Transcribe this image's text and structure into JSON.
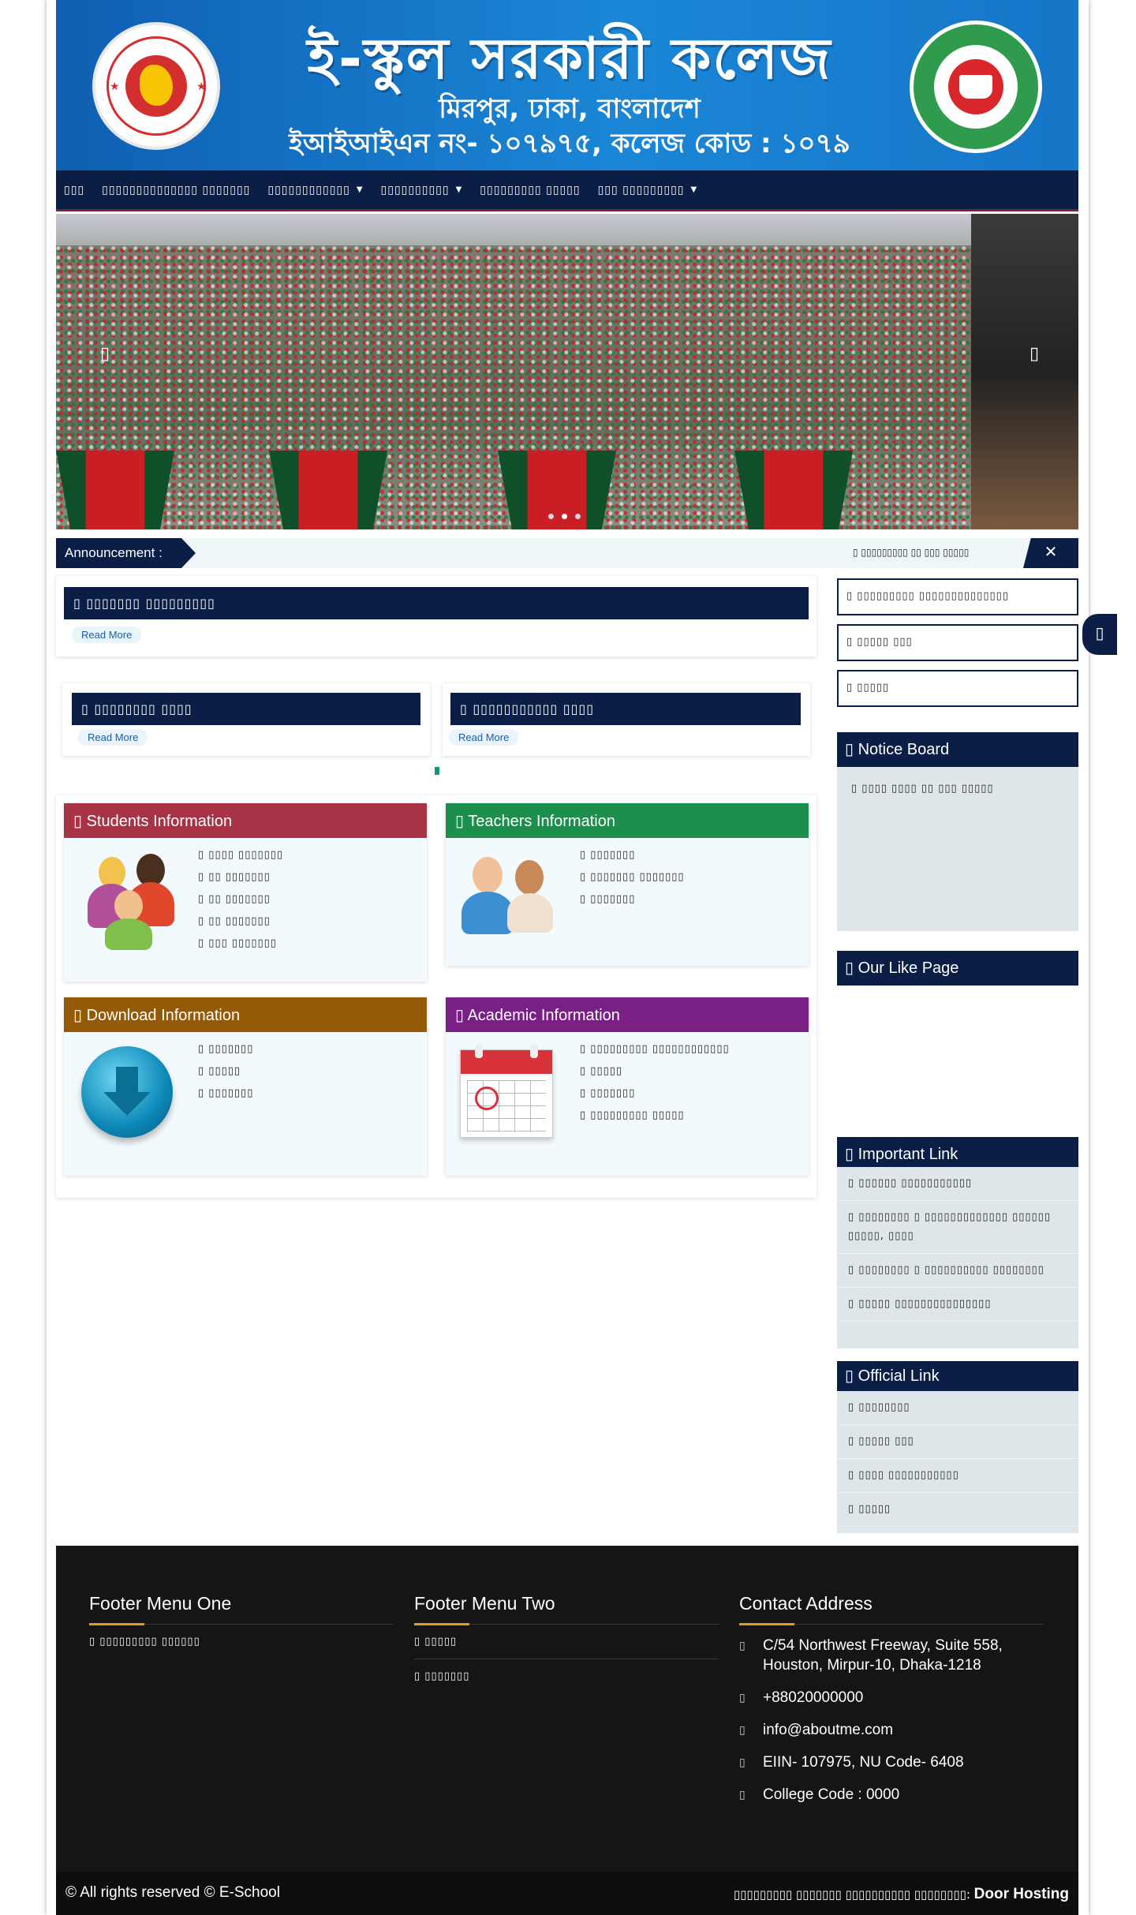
{
  "header": {
    "title": "ই-স্কুল সরকারী কলেজ",
    "subtitle": "মিরপুর, ঢাকা, বাংলাদেশ",
    "code_line": "ইআইআইএন নং- ১০৭৯৭৫, কলেজ কোড : ১০৭৯"
  },
  "nav": {
    "items": [
      {
        "label": "▯▯▯",
        "has_caret": false
      },
      {
        "label": "▯▯▯▯▯▯▯▯▯▯▯▯▯▯ ▯▯▯▯▯▯▯",
        "has_caret": false
      },
      {
        "label": "▯▯▯▯▯▯▯▯▯▯▯▯",
        "has_caret": true
      },
      {
        "label": "▯▯▯▯▯▯▯▯▯▯",
        "has_caret": true
      },
      {
        "label": "▯▯▯▯▯▯▯▯▯ ▯▯▯▯▯",
        "has_caret": false
      },
      {
        "label": "▯▯▯ ▯▯▯▯▯▯▯▯▯",
        "has_caret": true
      }
    ]
  },
  "slider": {
    "prev": "▯",
    "next": "▯",
    "dots": 3,
    "active_dot": 1
  },
  "announcement": {
    "label": "Announcement :",
    "text": "▯ ▯▯▯▯▯▯▯▯▯ ▯▯ ▯▯▯ ▯▯▯▯▯",
    "close": "✕"
  },
  "main": {
    "featured": {
      "title": "▯ ▯▯▯▯▯▯▯ ▯▯▯▯▯▯▯▯▯",
      "read_more": "Read More"
    },
    "cards": [
      {
        "title": "▯ ▯▯▯▯▯▯▯▯ ▯▯▯▯",
        "read_more": "Read More"
      },
      {
        "title": "▯ ▯▯▯▯▯▯▯▯▯▯▯ ▯▯▯▯",
        "read_more": "Read More"
      }
    ],
    "info_boxes": [
      {
        "title": "▯ Students Information",
        "color": "#a83346",
        "items": [
          "▯ ▯▯▯▯ ▯▯▯▯▯▯▯",
          "▯ ▯▯ ▯▯▯▯▯▯▯",
          "▯ ▯▯ ▯▯▯▯▯▯▯",
          "▯ ▯▯ ▯▯▯▯▯▯▯",
          "▯ ▯▯▯ ▯▯▯▯▯▯▯"
        ]
      },
      {
        "title": "▯ Teachers Information",
        "color": "#1b8f4b",
        "items": [
          "▯ ▯▯▯▯▯▯▯",
          "▯ ▯▯▯▯▯▯▯ ▯▯▯▯▯▯▯",
          "▯ ▯▯▯▯▯▯▯"
        ]
      },
      {
        "title": "▯ Download Information",
        "color": "#945a06",
        "items": [
          "▯ ▯▯▯▯▯▯▯",
          "▯ ▯▯▯▯▯",
          "▯ ▯▯▯▯▯▯▯"
        ]
      },
      {
        "title": "▯ Academic Information",
        "color": "#7a1f86",
        "items": [
          "▯ ▯▯▯▯▯▯▯▯▯ ▯▯▯▯▯▯▯▯▯▯▯▯",
          "▯ ▯▯▯▯▯",
          "▯ ▯▯▯▯▯▯▯",
          "▯ ▯▯▯▯▯▯▯▯▯ ▯▯▯▯▯"
        ]
      }
    ]
  },
  "sidebar": {
    "buttons": [
      "▯ ▯▯▯▯▯▯▯▯▯ ▯▯▯▯▯▯▯▯▯▯▯▯▯▯",
      "▯ ▯▯▯▯▯ ▯▯▯",
      "▯ ▯▯▯▯▯"
    ],
    "notice_board": {
      "title": "▯ Notice Board",
      "items": [
        "▯ ▯▯▯▯ ▯▯▯▯ ▯▯ ▯▯▯ ▯▯▯▯▯"
      ]
    },
    "like_page": {
      "title": "▯ Our Like Page"
    },
    "important_link": {
      "title": "▯ Important Link",
      "items": [
        "▯ ▯▯▯▯▯▯ ▯▯▯▯▯▯▯▯▯▯▯",
        "▯ ▯▯▯▯▯▯▯▯ ▯ ▯▯▯▯▯▯▯▯▯▯▯▯▯ ▯▯▯▯▯▯ ▯▯▯▯▯, ▯▯▯▯",
        "▯ ▯▯▯▯▯▯▯▯ ▯ ▯▯▯▯▯▯▯▯▯▯ ▯▯▯▯▯▯▯▯",
        "▯ ▯▯▯▯▯ ▯▯▯▯▯▯▯▯▯▯▯▯▯▯▯"
      ]
    },
    "official_link": {
      "title": "▯ Official Link",
      "items": [
        "▯ ▯▯▯▯▯▯▯▯",
        "▯ ▯▯▯▯▯ ▯▯▯",
        "▯ ▯▯▯▯ ▯▯▯▯▯▯▯▯▯▯▯",
        "▯ ▯▯▯▯▯"
      ]
    },
    "float_icon": "▯"
  },
  "footer": {
    "col1": {
      "title": "Footer Menu One",
      "links": [
        "▯ ▯▯▯▯▯▯▯▯▯ ▯▯▯▯▯▯"
      ]
    },
    "col2": {
      "title": "Footer Menu Two",
      "links": [
        "▯ ▯▯▯▯▯",
        "▯ ▯▯▯▯▯▯▯"
      ]
    },
    "contact": {
      "title": "Contact Address",
      "address": "C/54 Northwest Freeway, Suite 558, Houston, Mirpur-10, Dhaka-1218",
      "phone": "+88020000000",
      "email": "info@aboutme.com",
      "eiin": "EIIN- 107975, NU Code- 6408",
      "college_code": "College Code : 0000",
      "icon": "▯"
    },
    "copyright": "© All rights reserved © E-School",
    "credit_prefix": "▯▯▯▯▯▯▯▯▯ ▯▯▯▯▯▯▯ ▯▯▯▯▯▯▯▯▯▯ ▯▯▯▯▯▯▯▯:",
    "credit_name": "Door Hosting"
  }
}
